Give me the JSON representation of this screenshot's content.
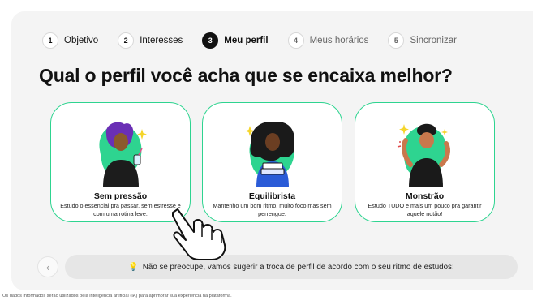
{
  "steps": [
    {
      "number": "1",
      "label": "Objetivo",
      "state": "done"
    },
    {
      "number": "2",
      "label": "Interesses",
      "state": "done"
    },
    {
      "number": "3",
      "label": "Meu perfil",
      "state": "active"
    },
    {
      "number": "4",
      "label": "Meus horários",
      "state": "future"
    },
    {
      "number": "5",
      "label": "Sincronizar",
      "state": "future"
    }
  ],
  "title": "Qual o perfil você acha que se encaixa melhor?",
  "cards": [
    {
      "name": "Sem pressão",
      "description": "Estudo o essencial pra passar, sem estresse e com uma rotina leve."
    },
    {
      "name": "Equilibrista",
      "description": "Mantenho um bom ritmo, muito foco mas sem perrengue."
    },
    {
      "name": "Monstrão",
      "description": "Estudo TUDO e mais um pouco pra garantir aquele notão!"
    }
  ],
  "notice": {
    "icon": "lightbulb-icon",
    "text": "Não se preocupe, vamos sugerir a troca de perfil de acordo com o seu ritmo de estudos!"
  },
  "prev_button": {
    "icon": "chevron-left-icon",
    "glyph": "‹"
  },
  "footer": "Os dados informados serão utilizados pela inteligência artificial (IA) para aprimorar sua experiência na plataforma.",
  "colors": {
    "accent": "#2ed490",
    "active_step": "#111111",
    "panel": "#f4f4f4",
    "notice_bg": "#e6e6e6"
  }
}
